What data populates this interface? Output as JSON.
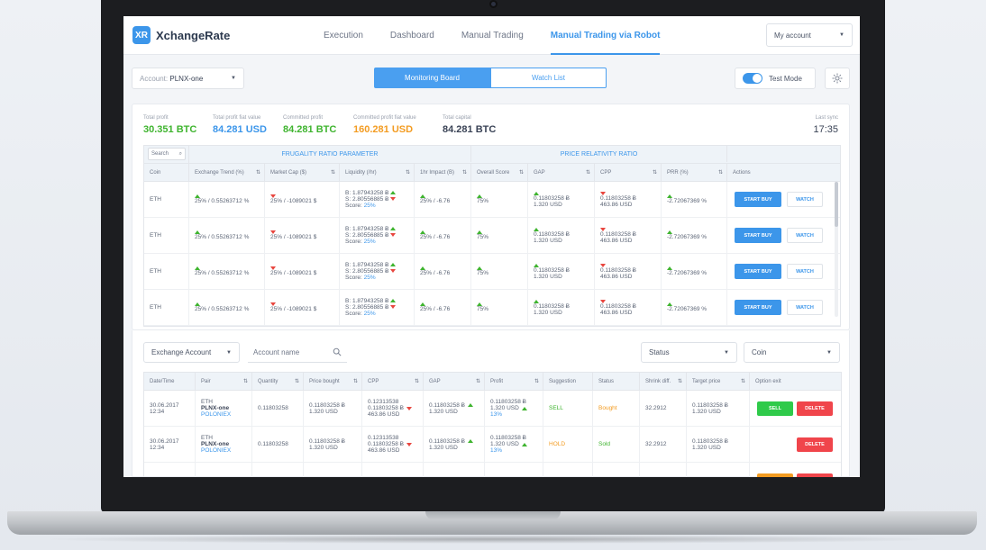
{
  "app": {
    "logo_mark": "XR",
    "name": "XchangeRate"
  },
  "nav": [
    {
      "label": "Execution",
      "active": false
    },
    {
      "label": "Dashboard",
      "active": false
    },
    {
      "label": "Manual Trading",
      "active": false
    },
    {
      "label": "Manual Trading via Robot",
      "active": true
    }
  ],
  "my_account": "My account",
  "toolbar": {
    "account_prefix": "Account:",
    "account_value": "PLNX-one",
    "tab_monitoring": "Monitoring Board",
    "tab_watchlist": "Watch List",
    "test_mode": "Test Mode",
    "settings_icon": "gear-icon"
  },
  "stats": [
    {
      "label": "Total profit",
      "value": "30.351 BTC",
      "color": "#3fb42f"
    },
    {
      "label": "Total profit fiat value",
      "value": "84.281 USD",
      "color": "#3c96ea"
    },
    {
      "label": "Committed profit",
      "value": "84.281 BTC",
      "color": "#3fb42f"
    },
    {
      "label": "Committed profit fiat value",
      "value": "160.281 USD",
      "color": "#f39c22"
    },
    {
      "label": "Total capital",
      "value": "84.281 BTC",
      "color": "#3a4356"
    }
  ],
  "sync": {
    "label": "Last sync",
    "value": "17:35"
  },
  "monitor_table": {
    "search": "Search",
    "group_frugality": "FRUGALITY RATIO PARAMETER",
    "group_relativity": "PRICE RELATIVITY RATIO",
    "headers": [
      "Coin",
      "Exchange Trend (%)",
      "Market Cap ($)",
      "Liquidity (/hr)",
      "1hr Impact (B)",
      "Overall Score",
      "GAP",
      "CPP",
      "PRR (%)",
      "Actions"
    ],
    "start_buy": "START BUY",
    "watch": "WATCH",
    "rows": [
      {
        "coin": "ETH",
        "trend": "25% / 0.55263712 %",
        "mcap": "25% / -1089021 $",
        "liq_b": "B: 1.87943258 Ƀ",
        "liq_s": "S: 2.80556885 Ƀ",
        "score_label": "Score:",
        "score": "25%",
        "impact": "25% / -6.76",
        "overall": "75%",
        "gap1": "0.11803258 Ƀ",
        "gap2": "1.320 USD",
        "cpp1": "0.11803258 Ƀ",
        "cpp2": "463.86 USD",
        "prr": "-2.72067369 %"
      },
      {
        "coin": "ETH",
        "trend": "25% / 0.55263712 %",
        "mcap": "25% / -1089021 $",
        "liq_b": "B: 1.87943258 Ƀ",
        "liq_s": "S: 2.80556885 Ƀ",
        "score_label": "Score:",
        "score": "25%",
        "impact": "25% / -6.76",
        "overall": "75%",
        "gap1": "0.11803258 Ƀ",
        "gap2": "1.320 USD",
        "cpp1": "0.11803258 Ƀ",
        "cpp2": "463.86 USD",
        "prr": "-2.72067369 %"
      },
      {
        "coin": "ETH",
        "trend": "25% / 0.55263712 %",
        "mcap": "25% / -1089021 $",
        "liq_b": "B: 1.87943258 Ƀ",
        "liq_s": "S: 2.80556885 Ƀ",
        "score_label": "Score:",
        "score": "25%",
        "impact": "25% / -6.76",
        "overall": "75%",
        "gap1": "0.11803258 Ƀ",
        "gap2": "1.320 USD",
        "cpp1": "0.11803258 Ƀ",
        "cpp2": "463.86 USD",
        "prr": "-2.72067369 %"
      },
      {
        "coin": "ETH",
        "trend": "25% / 0.55263712 %",
        "mcap": "25% / -1089021 $",
        "liq_b": "B: 1.87943258 Ƀ",
        "liq_s": "S: 2.80556885 Ƀ",
        "score_label": "Score:",
        "score": "25%",
        "impact": "25% / -6.76",
        "overall": "75%",
        "gap1": "0.11803258 Ƀ",
        "gap2": "1.320 USD",
        "cpp1": "0.11803258 Ƀ",
        "cpp2": "463.86 USD",
        "prr": "-2.72067369 %"
      }
    ]
  },
  "filters": {
    "exchange_account": "Exchange Account",
    "account_name_placeholder": "Account name",
    "status": "Status",
    "coin": "Coin"
  },
  "orders_table": {
    "headers": [
      "Date/Time",
      "Pair",
      "Quantity",
      "Price bought",
      "CPP",
      "GAP",
      "Profit",
      "Suggestion",
      "Status",
      "Shrink diff.",
      "Target price",
      "Option exit"
    ],
    "sell": "SELL",
    "delete": "DELETE",
    "rows": [
      {
        "date": "30.06.2017",
        "time": "12:34",
        "coin": "ETH",
        "pair": "PLNX-one",
        "exchange": "POLONIEX",
        "qty": "0.11803258",
        "pb1": "0.11803258 Ƀ",
        "pb2": "1.320 USD",
        "cpp1": "0.12313538",
        "cpp2": "0.11803258 Ƀ",
        "cpp3": "463.86 USD",
        "gap1": "0.11803258 Ƀ",
        "gap2": "1.320 USD",
        "pr1": "0.11803258 Ƀ",
        "pr2": "1.320 USD",
        "pr3": "13%",
        "suggestion": "SELL",
        "status": "Bought",
        "shrink": "32.2912",
        "tp1": "0.11803258 Ƀ",
        "tp2": "1.320 USD"
      },
      {
        "date": "30.06.2017",
        "time": "12:34",
        "coin": "ETH",
        "pair": "PLNX-one",
        "exchange": "POLONIEX",
        "qty": "0.11803258",
        "pb1": "0.11803258 Ƀ",
        "pb2": "1.320 USD",
        "cpp1": "0.12313538",
        "cpp2": "0.11803258 Ƀ",
        "cpp3": "463.86 USD",
        "gap1": "0.11803258 Ƀ",
        "gap2": "1.320 USD",
        "pr1": "0.11803258 Ƀ",
        "pr2": "1.320 USD",
        "pr3": "13%",
        "suggestion": "HOLD",
        "status": "Sold",
        "shrink": "32.2912",
        "tp1": "0.11803258 Ƀ",
        "tp2": "1.320 USD"
      },
      {
        "date": "30.06.2017",
        "time": "",
        "coin": "ETH",
        "pair": "",
        "exchange": "",
        "qty": "",
        "pb1": "",
        "pb2": "",
        "cpp1": "0.12313538",
        "cpp2": "",
        "cpp3": "",
        "gap1": "0.11803258 Ƀ",
        "gap2": "",
        "pr1": "0.11803258 Ƀ",
        "pr2": "",
        "pr3": "",
        "suggestion": "",
        "status": "",
        "shrink": "",
        "tp1": "",
        "tp2": ""
      }
    ]
  }
}
